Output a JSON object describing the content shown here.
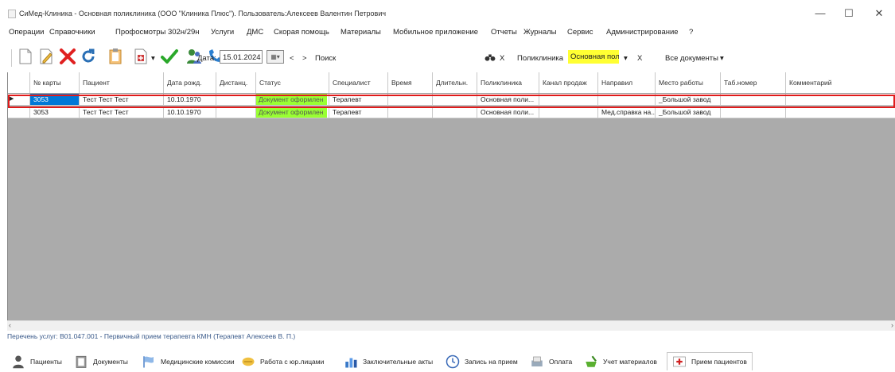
{
  "window": {
    "title": "СиМед-Клиника - Основная поликлиника (ООО \"Клиника Плюс\"). Пользователь:Алексеев Валентин Петрович",
    "minimize": "—",
    "maximize": "☐",
    "close": "✕"
  },
  "menu": [
    "Операции",
    "Справочники",
    "Профосмотры 302н/29н",
    "Услуги",
    "ДМС",
    "Скорая помощь",
    "Материалы",
    "Мобильное приложение",
    "Отчеты",
    "Журналы",
    "Сервис",
    "Администрирование",
    "?"
  ],
  "toolbar": {
    "date_label": "Дата:",
    "date_value": "15.01.2024",
    "prev": "<",
    "next": ">",
    "search_label": "Поиск",
    "search_clear": "X",
    "clinic_label": "Поликлиника",
    "clinic_value": "Основная поликл",
    "clinic_clear": "X",
    "docs_filter": "Все документы"
  },
  "grid": {
    "columns": [
      "№ карты",
      "Пациент",
      "Дата рожд.",
      "Дистанц.",
      "Статус",
      "Специалист",
      "Время",
      "Длительн.",
      "Поликлиника",
      "Канал продаж",
      "Направил",
      "Место работы",
      "Таб.номер",
      "Комментарий"
    ],
    "rows": [
      [
        "3053",
        "Тест Тест Тест",
        "10.10.1970",
        "",
        "Документ оформлен",
        "Терапевт",
        "",
        "",
        "Основная поли...",
        "",
        "",
        "_Большой завод",
        "",
        ""
      ],
      [
        "3053",
        "Тест Тест Тест",
        "10.10.1970",
        "",
        "Документ оформлен",
        "Терапевт",
        "",
        "",
        "Основная поли...",
        "",
        "Мед.справка на...",
        "_Большой завод",
        "",
        ""
      ]
    ],
    "status_color": "#99ff33",
    "selection_color": "#0078d7",
    "highlight_color": "#e01b1b"
  },
  "services_text": "Перечень услуг:  B01.047.001 - Первичный прием терапевта КМН (Терапевт Алексеев В. П.)",
  "tabs": [
    {
      "label": "Пациенты",
      "icon": "person-icon"
    },
    {
      "label": "Документы",
      "icon": "clipboard-icon"
    },
    {
      "label": "Медицинские комиссии",
      "icon": "flag-icon"
    },
    {
      "label": "Работа с юр.лицами",
      "icon": "handshake-icon"
    },
    {
      "label": "Заключительные акты",
      "icon": "chart-icon"
    },
    {
      "label": "Запись на прием",
      "icon": "clock-icon"
    },
    {
      "label": "Оплата",
      "icon": "payment-icon"
    },
    {
      "label": "Учет материалов",
      "icon": "mortar-icon"
    },
    {
      "label": "Прием пациентов",
      "icon": "medical-cross-icon"
    }
  ]
}
